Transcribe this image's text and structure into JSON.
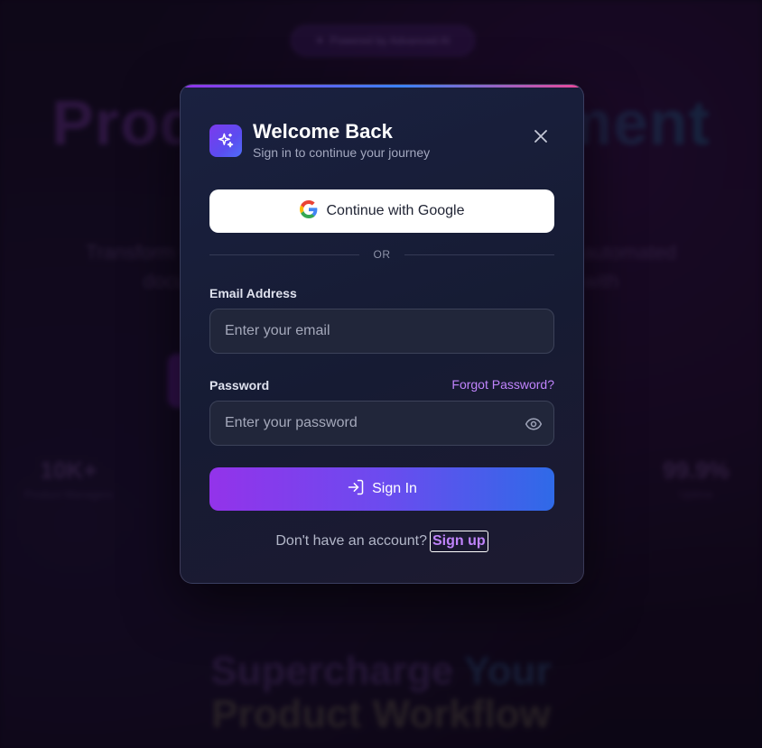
{
  "background": {
    "badge_text": "Powered by Advanced AI",
    "hero_title": "Product Management",
    "hero_subtitle_line1": "Transform your product workflow with AI-driven insights, automated",
    "hero_subtitle_line2": "documentation, and intelligent planning that scale with",
    "stats": [
      {
        "value": "10K+",
        "label": "Product Managers"
      },
      {
        "value": "99.9%",
        "label": "Uptime"
      }
    ],
    "bottom_line1_a": "Supercharge",
    "bottom_line1_b": "Your",
    "bottom_line2": "Product Workflow"
  },
  "modal": {
    "title": "Welcome Back",
    "subtitle": "Sign in to continue your journey",
    "logo_icon": "sparkles-icon",
    "close_icon": "close-icon",
    "google_button_label": "Continue with Google",
    "divider_text": "OR",
    "email": {
      "label": "Email Address",
      "placeholder": "Enter your email",
      "value": ""
    },
    "password": {
      "label": "Password",
      "placeholder": "Enter your password",
      "value": "",
      "toggle_icon": "eye-icon"
    },
    "forgot_password_label": "Forgot Password?",
    "signin_button_label": "Sign In",
    "footer_text": "Don't have an account?",
    "signup_label": "Sign up"
  },
  "colors": {
    "accent_purple": "#9333ea",
    "accent_blue": "#2f6ae8",
    "link": "#c084fc",
    "modal_bg": "#181d36"
  }
}
